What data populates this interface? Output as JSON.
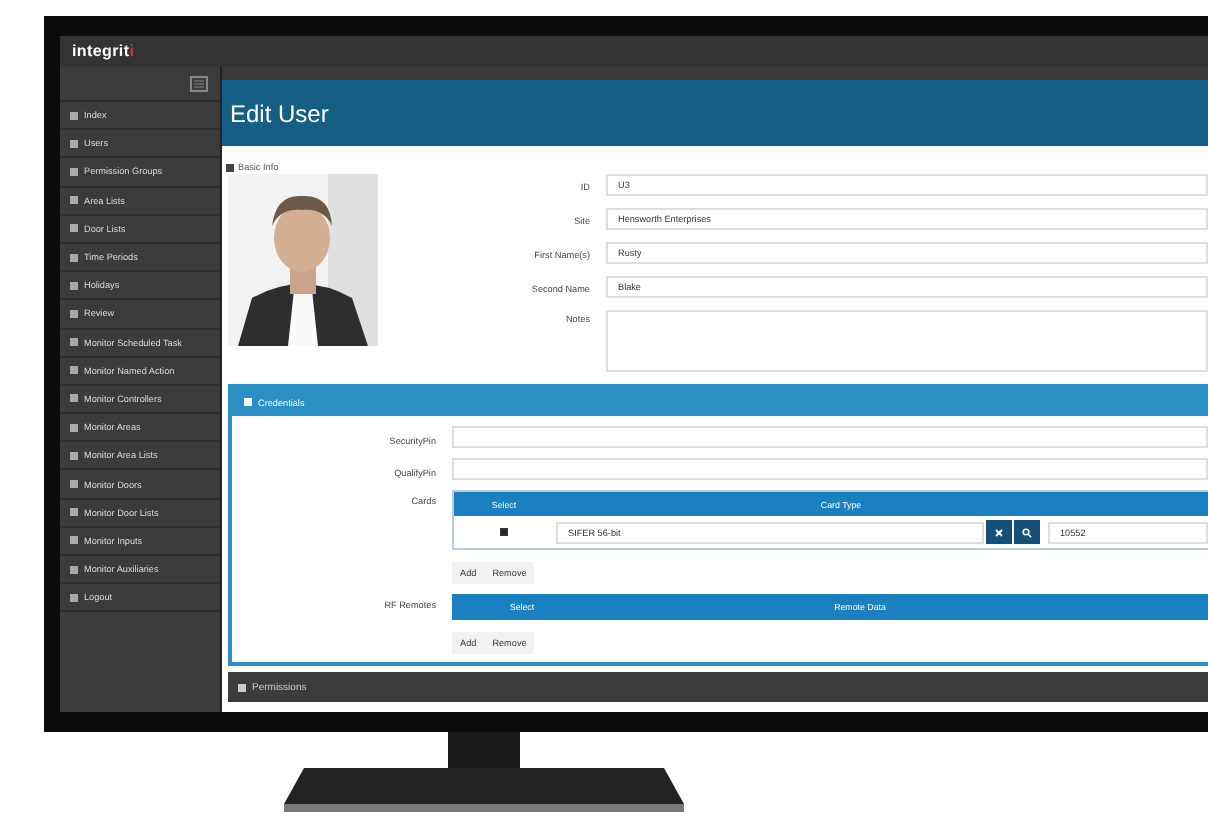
{
  "logo": {
    "text": "integrit",
    "accent": "i"
  },
  "sidebar": {
    "items": [
      {
        "label": "Index"
      },
      {
        "label": "Users"
      },
      {
        "label": "Permission Groups"
      },
      {
        "label": "Area Lists"
      },
      {
        "label": "Door Lists"
      },
      {
        "label": "Time Periods"
      },
      {
        "label": "Holidays"
      },
      {
        "label": "Review"
      },
      {
        "label": "Monitor Scheduled Task"
      },
      {
        "label": "Monitor Named Action"
      },
      {
        "label": "Monitor Controllers"
      },
      {
        "label": "Monitor Areas"
      },
      {
        "label": "Monitor Area Lists"
      },
      {
        "label": "Monitor Doors"
      },
      {
        "label": "Monitor Door Lists"
      },
      {
        "label": "Monitor Inputs"
      },
      {
        "label": "Monitor Auxiliaries"
      },
      {
        "label": "Logout"
      }
    ]
  },
  "page_title": "Edit User",
  "basic_info": {
    "title": "Basic Info",
    "fields": [
      {
        "label": "ID",
        "value": "U3"
      },
      {
        "label": "Site",
        "value": "Hensworth Enterprises"
      },
      {
        "label": "First Name(s)",
        "value": "Rusty"
      },
      {
        "label": "Second Name",
        "value": "Blake"
      }
    ],
    "notes": {
      "label": "Notes"
    }
  },
  "credentials": {
    "title": "Credentials",
    "fields": [
      {
        "label": "SecurityPin"
      },
      {
        "label": "QualifyPin"
      }
    ],
    "cards": {
      "label": "Cards",
      "columns": [
        "Select",
        "Card Type"
      ],
      "rows": [
        {
          "checked": true,
          "card_type": "SIFER 56-bit",
          "column_3": "10552"
        }
      ],
      "buttons": [
        "Add",
        "Remove"
      ]
    },
    "rf_remotes": {
      "label": "RF Remotes",
      "columns": [
        "Select",
        "Remote Data"
      ],
      "buttons": [
        "Add",
        "Remove"
      ]
    }
  },
  "permissions": {
    "title": "Permissions"
  }
}
